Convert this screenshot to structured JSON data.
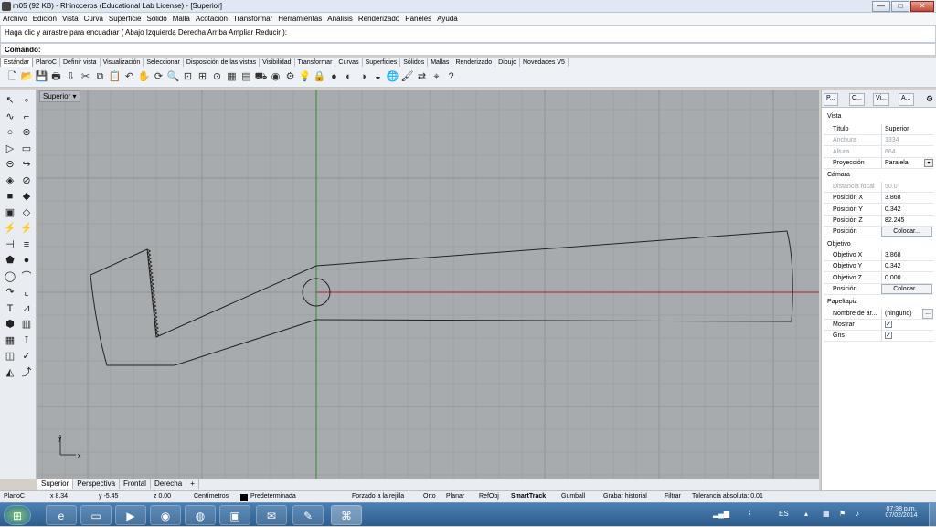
{
  "window": {
    "title": "m05 (92 KB) - Rhinoceros (Educational Lab License) - [Superior]",
    "min": "—",
    "max": "□",
    "close": "✕"
  },
  "menu": [
    "Archivo",
    "Edición",
    "Vista",
    "Curva",
    "Superficie",
    "Sólido",
    "Malla",
    "Acotación",
    "Transformar",
    "Herramientas",
    "Análisis",
    "Renderizado",
    "Paneles",
    "Ayuda"
  ],
  "command_history": "Haga clic y arrastre para encuadrar ( Abajo  Izquierda  Derecha  Arriba  Ampliar  Reducir ):",
  "command_label": "Comando:",
  "toolbar_tabs": [
    "Estándar",
    "PlanoC",
    "Definir vista",
    "Visualización",
    "Seleccionar",
    "Disposición de las vistas",
    "Visibilidad",
    "Transformar",
    "Curvas",
    "Superficies",
    "Sólidos",
    "Mallas",
    "Renderizado",
    "Dibujo",
    "Novedades V5"
  ],
  "toolbar_icons": [
    "new-icon",
    "open-icon",
    "save-icon",
    "print-icon",
    "import-icon",
    "cut-icon",
    "copy-icon",
    "paste-icon",
    "undo-icon",
    "pan-icon",
    "rotate-view-icon",
    "zoom-icon",
    "zoom-window-icon",
    "zoom-extents-icon",
    "zoom-selected-icon",
    "four-views-icon",
    "grid-icon",
    "car-icon",
    "eye-icon",
    "gear-icon",
    "bulb-icon",
    "lock-icon",
    "sphere-icon",
    "color-icon",
    "shade-icon",
    "render-icon",
    "globe-icon",
    "paint-icon",
    "transform-icon",
    "snap-icon",
    "help-icon"
  ],
  "viewport": {
    "label": "Superior",
    "axis_x": "x",
    "axis_y": "y"
  },
  "viewport_tabs": [
    "Superior",
    "Perspectiva",
    "Frontal",
    "Derecha",
    "+"
  ],
  "panel": {
    "tabs": [
      "P...",
      "C...",
      "Vi...",
      "A..."
    ],
    "vista_section": "Vista",
    "vista": [
      {
        "k": "Título",
        "v": "Superior",
        "dis": false
      },
      {
        "k": "Anchura",
        "v": "1334",
        "dis": true
      },
      {
        "k": "Altura",
        "v": "664",
        "dis": true
      },
      {
        "k": "Proyección",
        "v": "Paralela",
        "dis": false
      }
    ],
    "camara_section": "Cámara",
    "camara": [
      {
        "k": "Distancia focal",
        "v": "50.0",
        "dis": true
      },
      {
        "k": "Posición X",
        "v": "3.868",
        "dis": false
      },
      {
        "k": "Posición Y",
        "v": "0.342",
        "dis": false
      },
      {
        "k": "Posición Z",
        "v": "82.245",
        "dis": false
      }
    ],
    "camara_posicion": "Posición",
    "colocar": "Colocar...",
    "objetivo_section": "Objetivo",
    "objetivo": [
      {
        "k": "Objetivo X",
        "v": "3.868"
      },
      {
        "k": "Objetivo Y",
        "v": "0.342"
      },
      {
        "k": "Objetivo Z",
        "v": "0.000"
      }
    ],
    "objetivo_posicion": "Posición",
    "papel_section": "Papeltapiz",
    "nombre_label": "Nombre de ar...",
    "nombre_value": "(ninguno)",
    "browse": "...",
    "mostrar": "Mostrar",
    "gris": "Gris",
    "check": "✓"
  },
  "status": {
    "cplane": "PlanoC",
    "x": "x 8.34",
    "y": "y -5.45",
    "z": "z 0.00",
    "units": "Centímetros",
    "layer": "Predeterminada",
    "grid_snap": "Forzado a la rejilla",
    "orto": "Orto",
    "planar": "Planar",
    "refobj": "RefObj",
    "smarttrack": "SmartTrack",
    "gumball": "Gumball",
    "history": "Grabar historial",
    "filter": "Filtrar",
    "tolerance": "Tolerancia absoluta: 0.01"
  },
  "taskbar": {
    "apps": [
      "start-icon",
      "ie-icon",
      "folder-icon",
      "media-icon",
      "chrome-icon",
      "firefox-icon",
      "app-icon",
      "outlook-icon",
      "paint-icon",
      "rhino-icon"
    ],
    "lang": "ES",
    "time": "07:38 p.m.",
    "date": "07/02/2014"
  },
  "colors": {
    "viewport_bg": "#a8abae",
    "grid_minor": "#9ea1a4",
    "grid_major": "#8f9296",
    "x_axis": "#b22222",
    "y_axis": "#2e8b2e",
    "geometry": "#222222"
  }
}
